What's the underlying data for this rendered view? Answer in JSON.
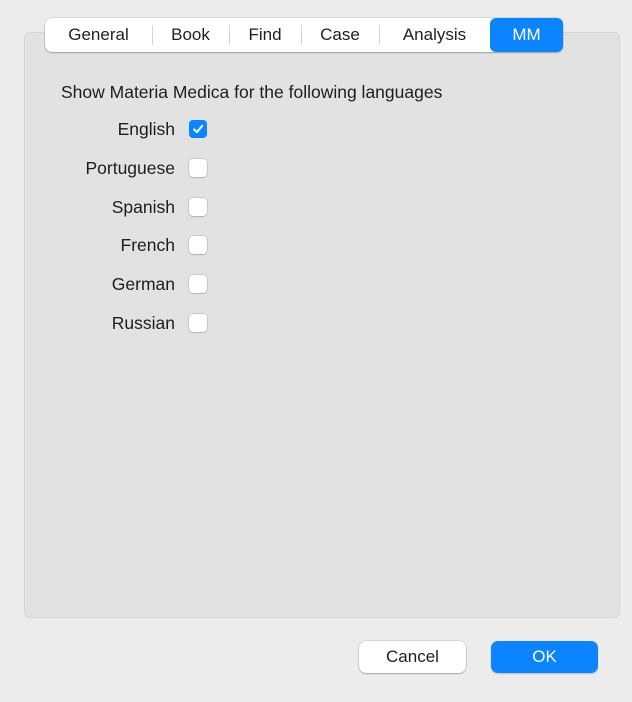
{
  "tabs": [
    {
      "label": "General",
      "selected": false
    },
    {
      "label": "Book",
      "selected": false
    },
    {
      "label": "Find",
      "selected": false
    },
    {
      "label": "Case",
      "selected": false
    },
    {
      "label": "Analysis",
      "selected": false
    },
    {
      "label": "MM",
      "selected": true
    }
  ],
  "mm": {
    "heading": "Show Materia Medica for the following languages",
    "languages": [
      {
        "label": "English",
        "checked": true
      },
      {
        "label": "Portuguese",
        "checked": false
      },
      {
        "label": "Spanish",
        "checked": false
      },
      {
        "label": "French",
        "checked": false
      },
      {
        "label": "German",
        "checked": false
      },
      {
        "label": "Russian",
        "checked": false
      }
    ]
  },
  "buttons": {
    "cancel": "Cancel",
    "ok": "OK"
  },
  "colors": {
    "accent": "#0a84ff",
    "background": "#ececec",
    "group_box": "#e2e2e2"
  }
}
